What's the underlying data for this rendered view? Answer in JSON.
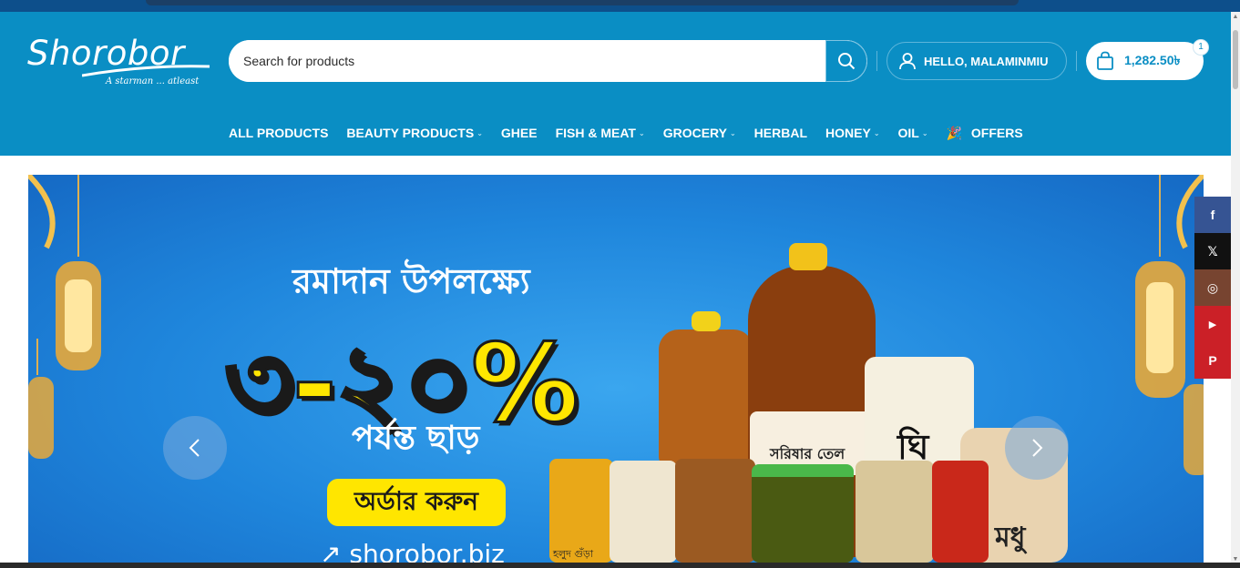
{
  "brand": {
    "name": "Shorobor",
    "tagline": "A starman ... atleast"
  },
  "search": {
    "placeholder": "Search for products"
  },
  "account": {
    "label": "HELLO, MALAMINMIU"
  },
  "cart": {
    "amount": "1,282.50৳",
    "count": "1"
  },
  "nav": {
    "items": [
      {
        "label": "ALL PRODUCTS",
        "dropdown": false
      },
      {
        "label": "BEAUTY PRODUCTS",
        "dropdown": true
      },
      {
        "label": "GHEE",
        "dropdown": false
      },
      {
        "label": "FISH & MEAT",
        "dropdown": true
      },
      {
        "label": "GROCERY",
        "dropdown": true
      },
      {
        "label": "HERBAL",
        "dropdown": false
      },
      {
        "label": "HONEY",
        "dropdown": true
      },
      {
        "label": "OIL",
        "dropdown": true
      },
      {
        "label": "OFFERS",
        "dropdown": false,
        "icon": "party-popper-icon"
      }
    ]
  },
  "banner": {
    "headline": "রমাদান উপলক্ষ্যে",
    "discount": "৩-২০%",
    "subline": "পর্যন্ত ছাড়",
    "cta": "অর্ডার করুন",
    "website": "↗ shorobor.biz",
    "product_labels": {
      "mustard_oil": "সরিষার তেল",
      "ghee": "ঘি",
      "honey": "মধু",
      "turmeric": "হলুদ গুঁড়া"
    }
  },
  "social": [
    {
      "name": "facebook",
      "glyph": "f",
      "color": "#365493"
    },
    {
      "name": "x",
      "glyph": "𝕏",
      "color": "#111111"
    },
    {
      "name": "instagram",
      "glyph": "◎",
      "color": "#774430"
    },
    {
      "name": "youtube",
      "glyph": "▶",
      "color": "#cb2027"
    },
    {
      "name": "pinterest",
      "glyph": "P",
      "color": "#cb2027"
    }
  ],
  "colors": {
    "header": "#0a8ec4",
    "accent_yellow": "#ffe600"
  }
}
